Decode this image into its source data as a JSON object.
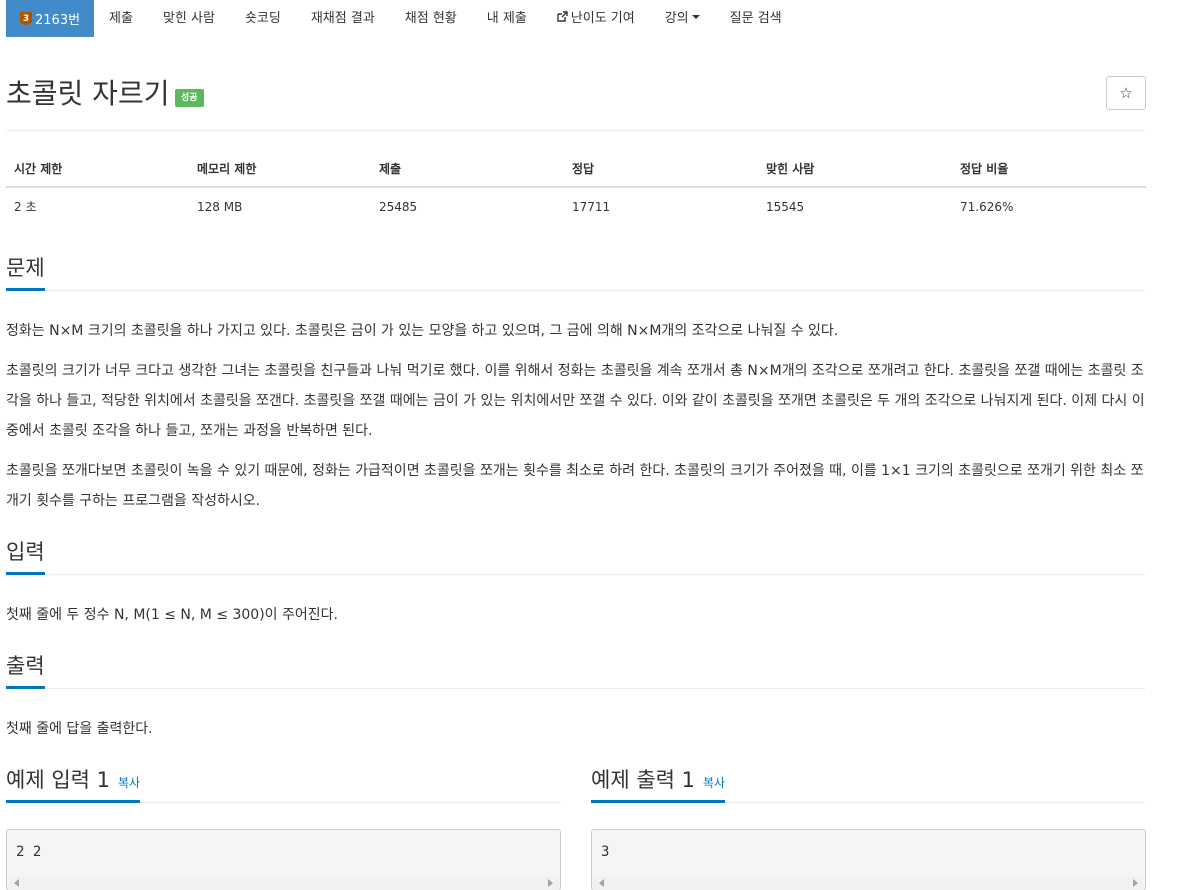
{
  "nav": {
    "problem_id": "2163번",
    "tier": "3",
    "items": [
      "제출",
      "맞힌 사람",
      "숏코딩",
      "재채점 결과",
      "채점 현황",
      "내 제출",
      "난이도 기여",
      "강의",
      "질문 검색"
    ]
  },
  "problem": {
    "title": "초콜릿 자르기",
    "status_label": "성공",
    "star": "☆"
  },
  "stats": {
    "headers": [
      "시간 제한",
      "메모리 제한",
      "제출",
      "정답",
      "맞힌 사람",
      "정답 비율"
    ],
    "values": [
      "2 초",
      "128 MB",
      "25485",
      "17711",
      "15545",
      "71.626%"
    ]
  },
  "sections": {
    "description": {
      "heading": "문제",
      "paragraphs": [
        "정화는 N×M 크기의 초콜릿을 하나 가지고 있다. 초콜릿은 금이 가 있는 모양을 하고 있으며, 그 금에 의해 N×M개의 조각으로 나눠질 수 있다.",
        "초콜릿의 크기가 너무 크다고 생각한 그녀는 초콜릿을 친구들과 나눠 먹기로 했다. 이를 위해서 정화는 초콜릿을 계속 쪼개서 총 N×M개의 조각으로 쪼개려고 한다. 초콜릿을 쪼갤 때에는 초콜릿 조각을 하나 들고, 적당한 위치에서 초콜릿을 쪼갠다. 초콜릿을 쪼갤 때에는 금이 가 있는 위치에서만 쪼갤 수 있다. 이와 같이 초콜릿을 쪼개면 초콜릿은 두 개의 조각으로 나눠지게 된다. 이제 다시 이 중에서 초콜릿 조각을 하나 들고, 쪼개는 과정을 반복하면 된다.",
        "초콜릿을 쪼개다보면 초콜릿이 녹을 수 있기 때문에, 정화는 가급적이면 초콜릿을 쪼개는 횟수를 최소로 하려 한다. 초콜릿의 크기가 주어졌을 때, 이를 1×1 크기의 초콜릿으로 쪼개기 위한 최소 쪼개기 횟수를 구하는 프로그램을 작성하시오."
      ]
    },
    "input": {
      "heading": "입력",
      "text": "첫째 줄에 두 정수 N, M(1 ≤ N, M ≤ 300)이 주어진다."
    },
    "output": {
      "heading": "출력",
      "text": "첫째 줄에 답을 출력한다."
    },
    "sample_input": {
      "heading": "예제 입력 1",
      "copy": "복사",
      "code": "2 2"
    },
    "sample_output": {
      "heading": "예제 출력 1",
      "copy": "복사",
      "code": "3"
    }
  },
  "colors": {
    "nav_active": "#428bca",
    "success": "#5cb85c",
    "accent": "#0076c0"
  }
}
